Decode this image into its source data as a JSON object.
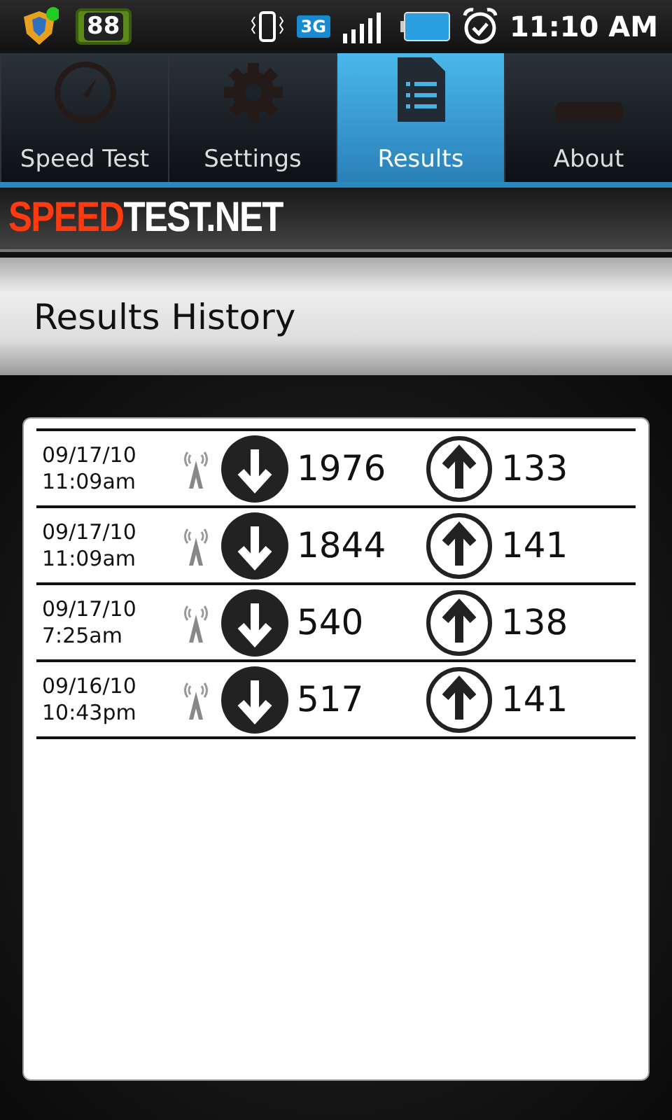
{
  "status_bar": {
    "badge": "88",
    "network": "3G",
    "time": "11:10 AM"
  },
  "tabs": [
    {
      "label": "Speed Test",
      "selected": false
    },
    {
      "label": "Settings",
      "selected": false
    },
    {
      "label": "Results",
      "selected": true
    },
    {
      "label": "About",
      "selected": false
    }
  ],
  "brand": {
    "part_1": "SPEED",
    "part_2": "TEST.NET"
  },
  "header": {
    "title": "Results History"
  },
  "results": [
    {
      "date": "09/17/10",
      "time": "11:09am",
      "download": "1976",
      "upload": "133"
    },
    {
      "date": "09/17/10",
      "time": "11:09am",
      "download": "1844",
      "upload": "141"
    },
    {
      "date": "09/17/10",
      "time": "7:25am",
      "download": "540",
      "upload": "138"
    },
    {
      "date": "09/16/10",
      "time": "10:43pm",
      "download": "517",
      "upload": "141"
    }
  ]
}
